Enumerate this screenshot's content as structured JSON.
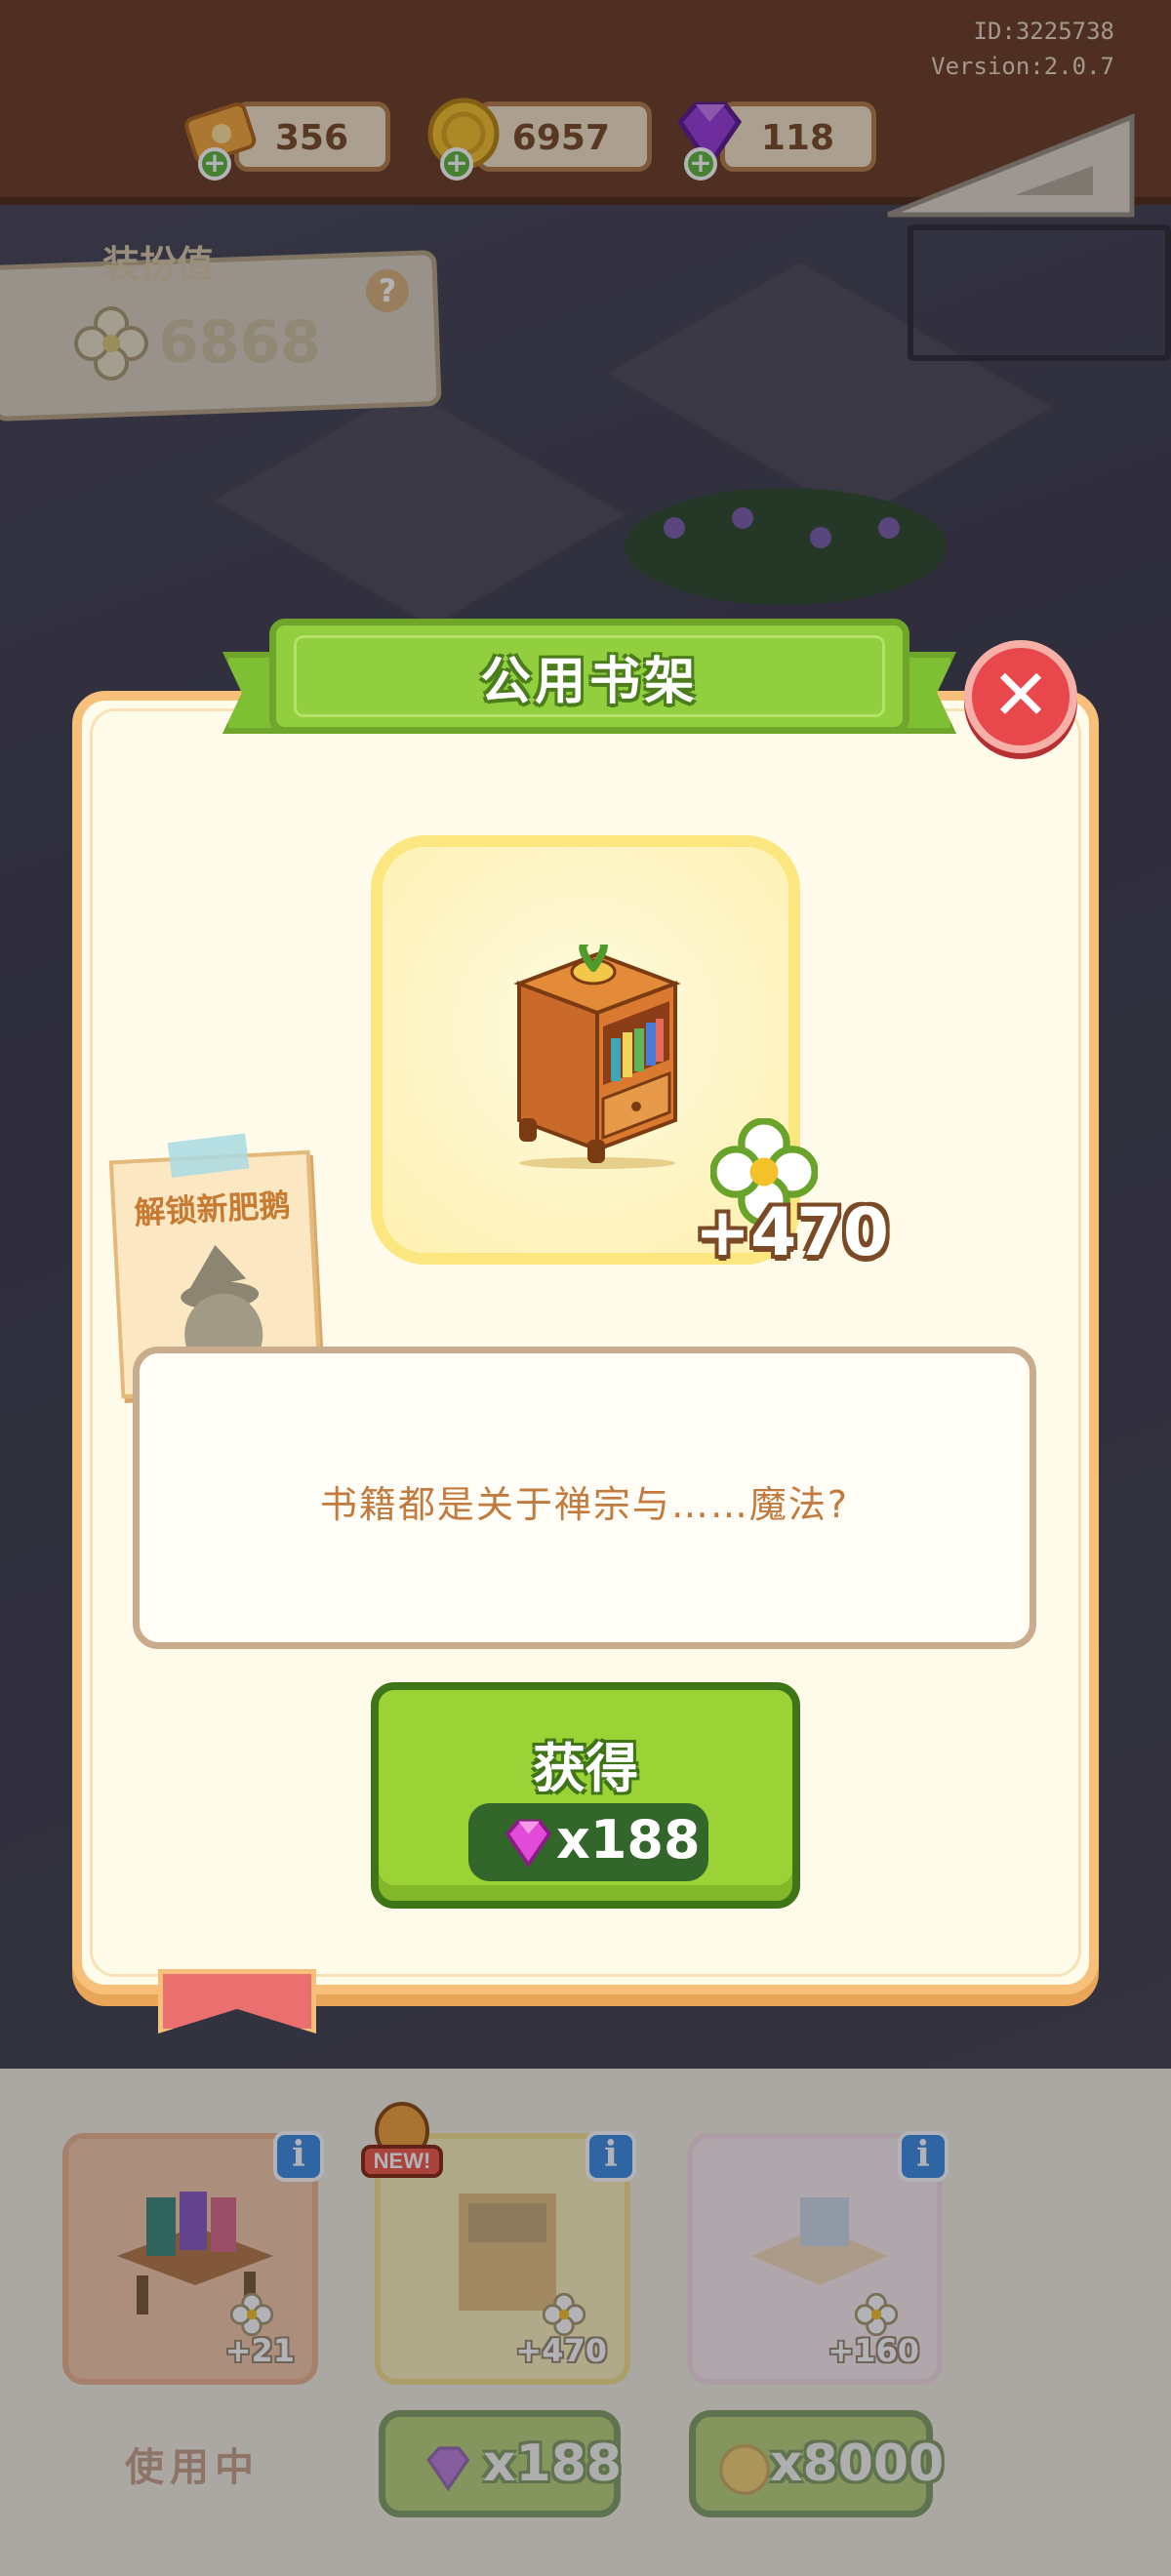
{
  "header": {
    "player_id": "ID:3225738",
    "version": "Version:2.0.7",
    "resources": [
      {
        "icon": "ticket-icon",
        "value": "356"
      },
      {
        "icon": "coin-icon",
        "value": "6957"
      },
      {
        "icon": "gem-icon",
        "value": "118"
      }
    ]
  },
  "decor_panel": {
    "label": "装扮值",
    "value": "6868",
    "help": "?"
  },
  "dialog": {
    "title": "公用书架",
    "close": "✕",
    "reward_value": "+470",
    "unlock_note": "解锁新肥鹅",
    "description": "书籍都是关于禅宗与……魔法?",
    "get_button": {
      "label": "获得",
      "price": "x188"
    }
  },
  "bottom_panel": {
    "cards": [
      {
        "value": "+21",
        "status": "使用中"
      },
      {
        "value": "+470",
        "tag": "NEW!",
        "price": "x188"
      },
      {
        "value": "+160",
        "price": "x8000"
      }
    ],
    "info_label": "i"
  },
  "colors": {
    "accent_green": "#9bd236",
    "close_red": "#e8484c",
    "frame_orange": "#f6c07a",
    "text_brown": "#c27a3e"
  }
}
